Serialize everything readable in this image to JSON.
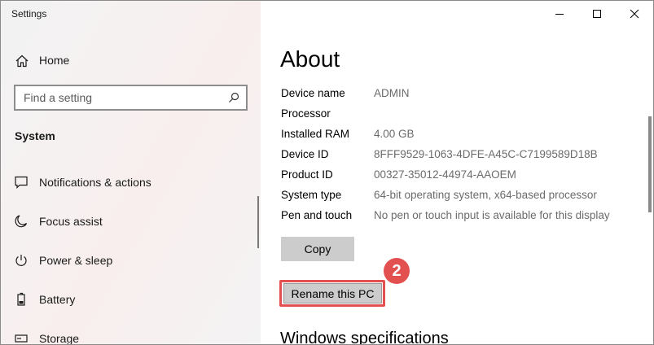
{
  "window": {
    "title": "Settings",
    "controls": {
      "minimize": "minimize-icon",
      "maximize": "maximize-icon",
      "close": "close-icon"
    }
  },
  "sidebar": {
    "home_label": "Home",
    "search": {
      "placeholder": "Find a setting",
      "value": ""
    },
    "section_title": "System",
    "items": [
      {
        "label": "Notifications & actions",
        "icon": "notification-icon"
      },
      {
        "label": "Focus assist",
        "icon": "moon-icon"
      },
      {
        "label": "Power & sleep",
        "icon": "power-icon"
      },
      {
        "label": "Battery",
        "icon": "battery-icon"
      },
      {
        "label": "Storage",
        "icon": "storage-icon"
      }
    ]
  },
  "main": {
    "title": "About",
    "specs": [
      {
        "label": "Device name",
        "value": "ADMIN"
      },
      {
        "label": "Processor",
        "value": ""
      },
      {
        "label": "Installed RAM",
        "value": "4.00 GB"
      },
      {
        "label": "Device ID",
        "value": "8FFF9529-1063-4DFE-A45C-C7199589D18B"
      },
      {
        "label": "Product ID",
        "value": "00327-35012-44974-AAOEM"
      },
      {
        "label": "System type",
        "value": "64-bit operating system, x64-based processor"
      },
      {
        "label": "Pen and touch",
        "value": "No pen or touch input is available for this display"
      }
    ],
    "copy_label": "Copy",
    "rename_label": "Rename this PC",
    "step_badge": "2",
    "windows_spec_heading": "Windows specifications"
  },
  "colors": {
    "highlight": "#e2504f",
    "button_bg": "#cccccc",
    "muted_text": "#6b6b6b"
  }
}
